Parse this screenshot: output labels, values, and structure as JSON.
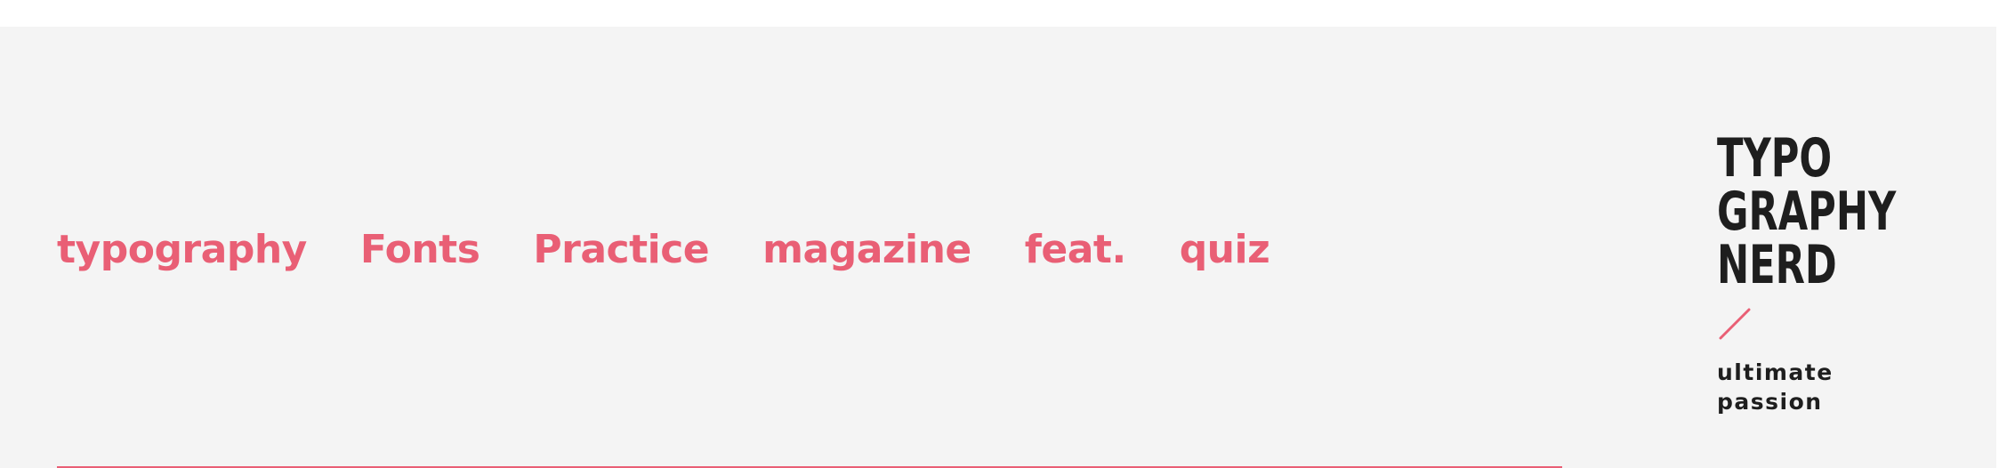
{
  "nav": {
    "items": [
      {
        "label": "typography"
      },
      {
        "label": "Fonts"
      },
      {
        "label": "Practice"
      },
      {
        "label": "magazine"
      },
      {
        "label": "feat."
      },
      {
        "label": "quiz"
      }
    ]
  },
  "brand": {
    "logo_lines": [
      "TYPO",
      "GRAPHY",
      "NERD"
    ],
    "tagline_lines": [
      "ultimate",
      "passion"
    ]
  },
  "colors": {
    "accent": "#e95f75",
    "text_dark": "#1e1e1e",
    "header_background": "#f4f4f4",
    "page_background": "#ffffff"
  },
  "icons": {
    "logo_mark": "slash-icon"
  }
}
